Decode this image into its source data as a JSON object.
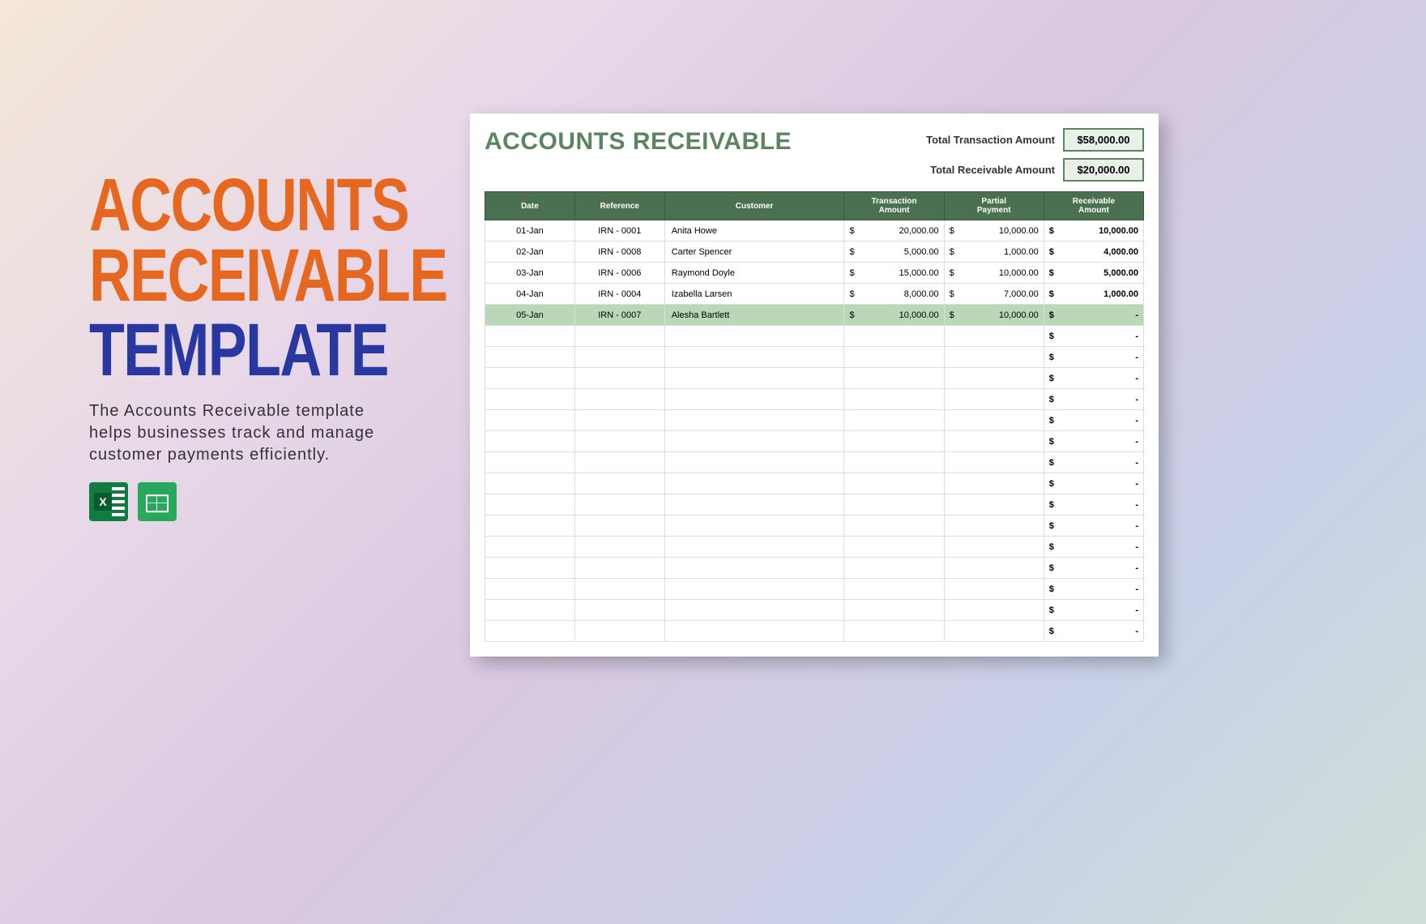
{
  "hero": {
    "line1": "ACCOUNTS",
    "line2": "RECEIVABLE",
    "line3": "TEMPLATE",
    "description": "The Accounts Receivable template helps businesses track and manage customer payments efficiently.",
    "icons": {
      "excel": "excel-icon",
      "sheets": "google-sheets-icon"
    }
  },
  "sheet": {
    "title": "ACCOUNTS RECEIVABLE",
    "totals": {
      "transaction_label": "Total Transaction Amount",
      "transaction_value": "$58,000.00",
      "receivable_label": "Total Receivable Amount",
      "receivable_value": "$20,000.00"
    },
    "columns": {
      "date": "Date",
      "reference": "Reference",
      "customer": "Customer",
      "transaction1": "Transaction",
      "transaction2": "Amount",
      "partial1": "Partial",
      "partial2": "Payment",
      "receivable1": "Receivable",
      "receivable2": "Amount"
    },
    "currency": "$",
    "rows": [
      {
        "date": "01-Jan",
        "ref": "IRN - 0001",
        "cust": "Anita Howe",
        "txn": "20,000.00",
        "partial": "10,000.00",
        "recv": "10,000.00",
        "hl": false
      },
      {
        "date": "02-Jan",
        "ref": "IRN - 0008",
        "cust": "Carter Spencer",
        "txn": "5,000.00",
        "partial": "1,000.00",
        "recv": "4,000.00",
        "hl": false
      },
      {
        "date": "03-Jan",
        "ref": "IRN - 0006",
        "cust": "Raymond Doyle",
        "txn": "15,000.00",
        "partial": "10,000.00",
        "recv": "5,000.00",
        "hl": false
      },
      {
        "date": "04-Jan",
        "ref": "IRN - 0004",
        "cust": "Izabella Larsen",
        "txn": "8,000.00",
        "partial": "7,000.00",
        "recv": "1,000.00",
        "hl": false
      },
      {
        "date": "05-Jan",
        "ref": "IRN - 0007",
        "cust": "Alesha Bartlett",
        "txn": "10,000.00",
        "partial": "10,000.00",
        "recv": "-",
        "hl": true
      }
    ],
    "empty_rows": 15,
    "empty_recv": "-"
  }
}
